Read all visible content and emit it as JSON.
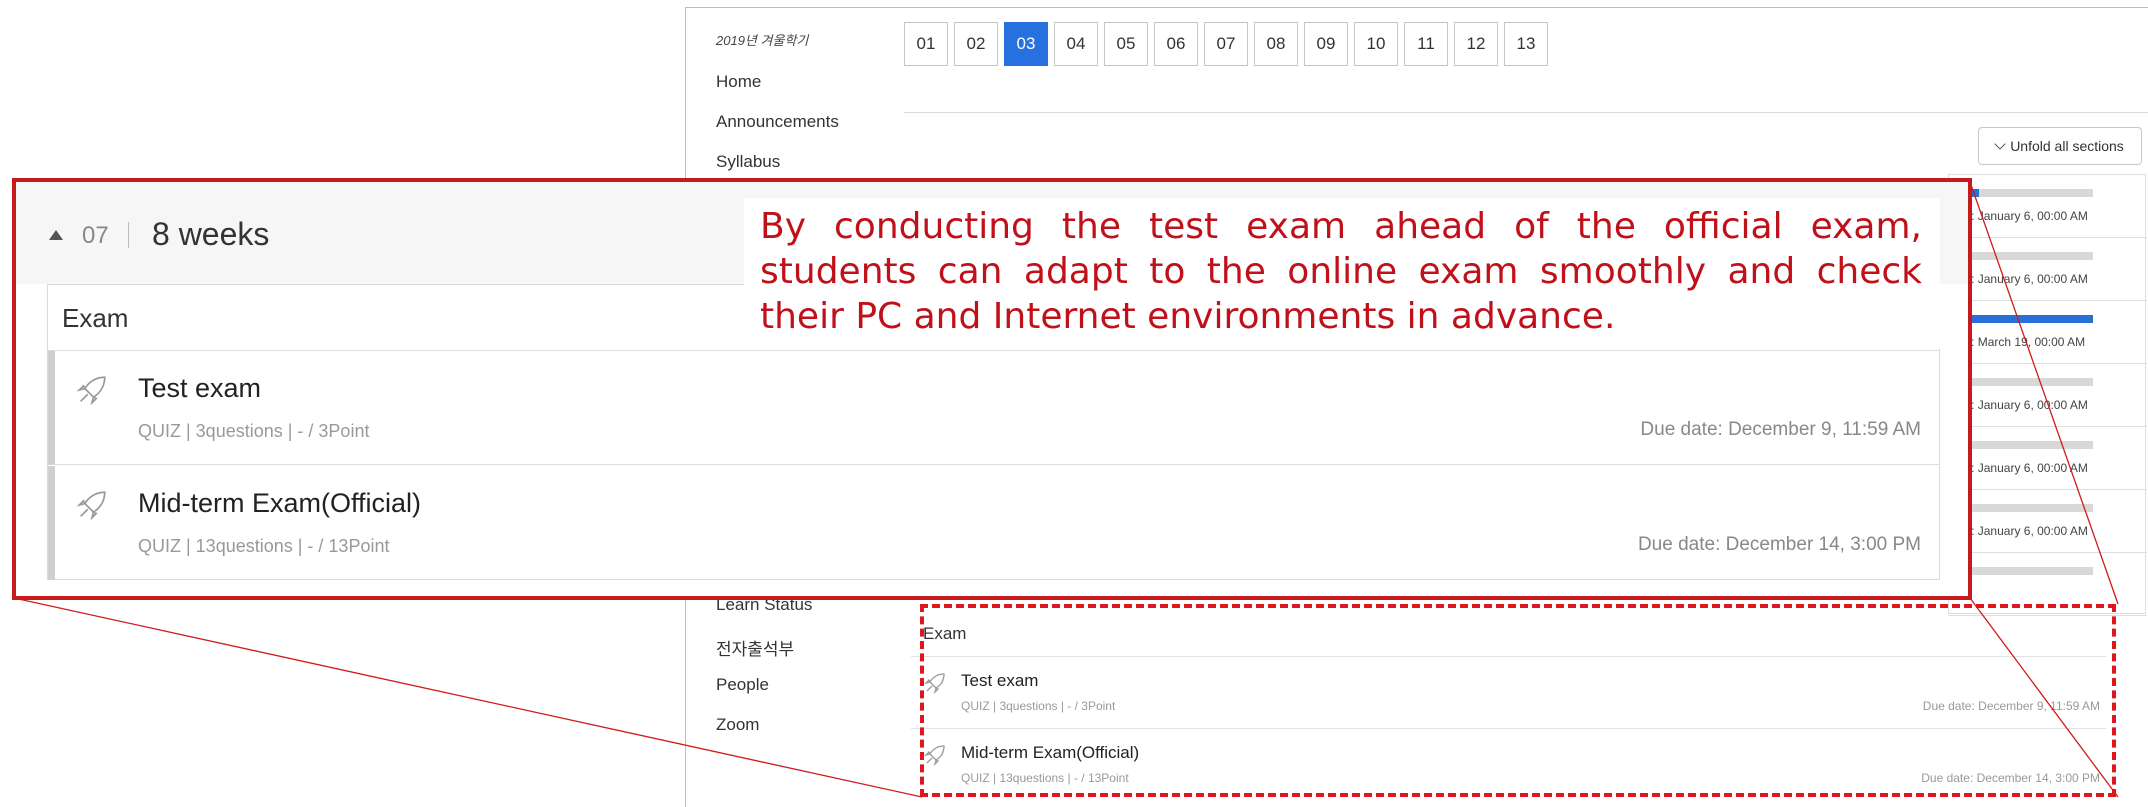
{
  "nav": {
    "term": "2019년 겨울학기",
    "items_top": [
      "Home",
      "Announcements",
      "Syllabus"
    ],
    "items_bottom": [
      "Learn Status",
      "전자출석부",
      "People",
      "Zoom"
    ]
  },
  "week_tabs": [
    "01",
    "02",
    "03",
    "04",
    "05",
    "06",
    "07",
    "08",
    "09",
    "10",
    "11",
    "12",
    "13"
  ],
  "active_tab": "03",
  "unfold_label": "Unfold all sections",
  "progress_rows": [
    {
      "label": "작일:  January 6, 00:00 AM",
      "fill": 0.2
    },
    {
      "label": "작일:  January 6, 00:00 AM",
      "fill": 0.0
    },
    {
      "label": "작일:  March 19, 00:00 AM",
      "fill": 1.0
    },
    {
      "label": "작일:  January 6, 00:00 AM",
      "fill": 0.0
    },
    {
      "label": "작일:  January 6, 00:00 AM",
      "fill": 0.0
    },
    {
      "label": "작일:  January 6, 00:00 AM",
      "fill": 0.0
    },
    {
      "label": "",
      "fill": 0.0
    }
  ],
  "week_section": {
    "number": "07",
    "title": "8 weeks",
    "group_label": "Exam",
    "items": [
      {
        "title": "Test exam",
        "meta": "QUIZ | 3questions | - / 3Point",
        "due": "Due date: December 9, 11:59 AM"
      },
      {
        "title": "Mid-term Exam(Official)",
        "meta": "QUIZ | 13questions | - / 13Point",
        "due": "Due date: December 14, 3:00 PM"
      }
    ]
  },
  "annotation": "By conducting the test exam ahead of the official exam, students can adapt to the online exam smoothly and check their PC and Internet environments in advance.",
  "colors": {
    "accent": "#2770e0",
    "annotation_red": "#c0111a",
    "dashed_red": "#e0161d"
  }
}
